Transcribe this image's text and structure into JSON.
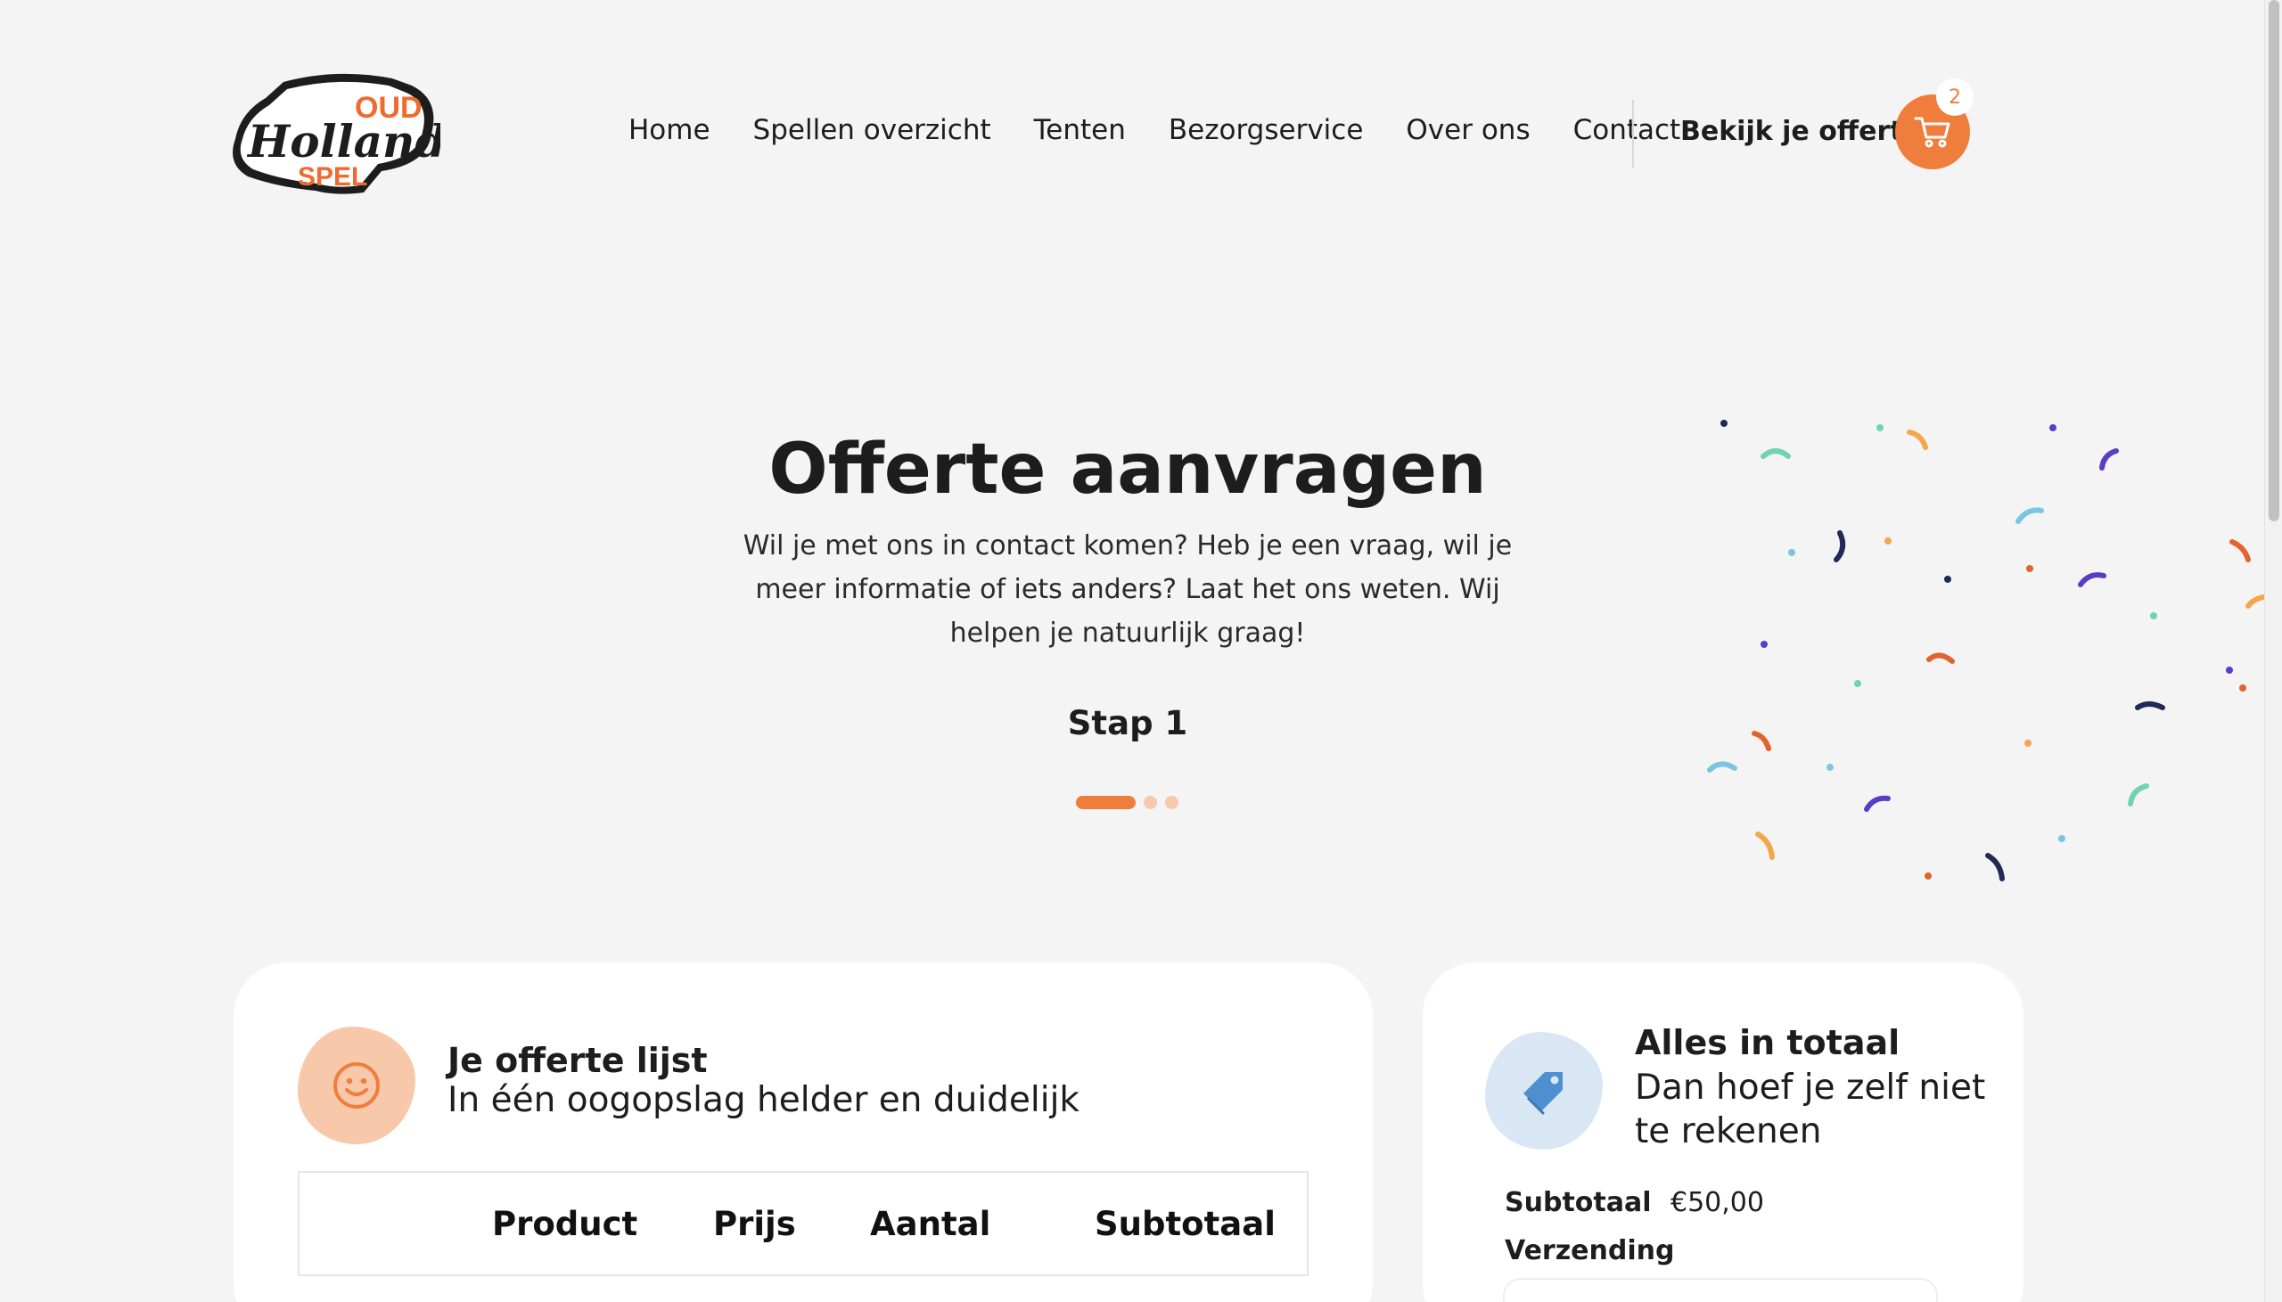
{
  "header": {
    "logo_alt": "Oud Hollands Spel",
    "logo_words": [
      "OUD",
      "Hollands",
      "SPEL"
    ],
    "nav": [
      "Home",
      "Spellen overzicht",
      "Tenten",
      "Bezorgservice",
      "Over ons",
      "Contact"
    ],
    "offer_link": "Bekijk je offerte",
    "cart_count": "2",
    "cart_icon": "shopping-cart-icon"
  },
  "hero": {
    "title": "Offerte aanvragen",
    "subtitle": "Wil je met ons in contact komen? Heb je een vraag, wil je meer informatie of iets anders? Laat het ons weten. Wij helpen je natuurlijk graag!",
    "step_label": "Stap 1",
    "steps_total": 3,
    "current_step": 1
  },
  "offer_list": {
    "icon": "smiley-icon",
    "title": "Je offerte lijst",
    "subtitle": "In één oogopslag helder en duidelijk",
    "columns": [
      "Product",
      "Prijs",
      "Aantal",
      "Subtotaal"
    ]
  },
  "totals": {
    "icon": "price-tag-icon",
    "title": "Alles in totaal",
    "subtitle": "Dan hoef je zelf niet te rekenen",
    "subtotal_label": "Subtotaal",
    "subtotal_value": "€50,00",
    "shipping_label": "Verzending"
  },
  "colors": {
    "accent": "#ef7d3c",
    "background": "#f4f4f4",
    "card": "#ffffff",
    "text": "#1d1d1d",
    "blob_orange": "#f8c8ab",
    "blob_blue": "#d8e7f3"
  }
}
